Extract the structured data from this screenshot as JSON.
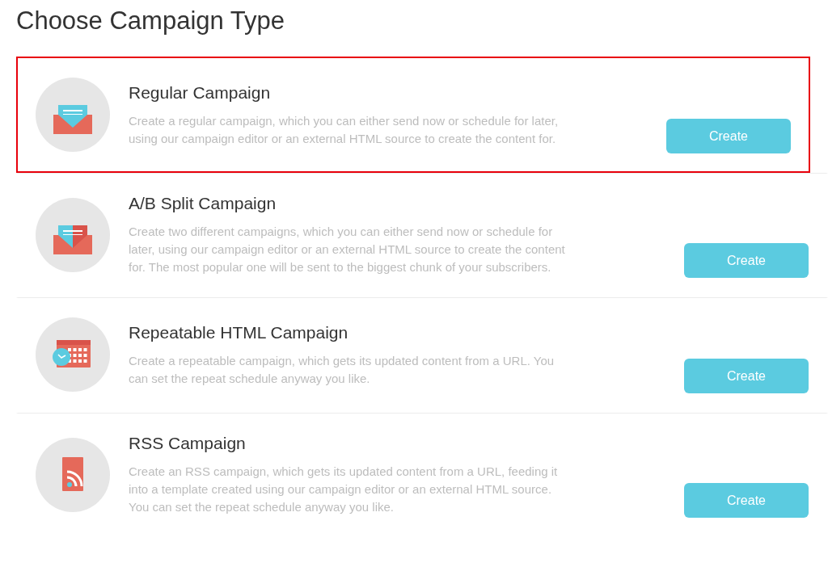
{
  "page_title": "Choose Campaign Type",
  "campaigns": [
    {
      "kind": "envelope",
      "title": "Regular Campaign",
      "description": "Create a regular campaign, which you can either send now or schedule for later, using our campaign editor or an external HTML source to create the content for.",
      "button": "Create",
      "selected": true
    },
    {
      "kind": "split-envelope",
      "title": "A/B Split Campaign",
      "description": "Create two different campaigns, which you can either send now or schedule for later, using our campaign editor or an external HTML source to create the content for. The most popular one will be sent to the biggest chunk of your subscribers.",
      "button": "Create",
      "selected": false
    },
    {
      "kind": "calendar-clock",
      "title": "Repeatable HTML Campaign",
      "description": "Create a repeatable campaign, which gets its updated content from a URL. You can set the repeat schedule anyway you like.",
      "button": "Create",
      "selected": false
    },
    {
      "kind": "rss",
      "title": "RSS Campaign",
      "description": "Create an RSS campaign, which gets its updated content from a URL, feeding it into a template created using our campaign editor or an external HTML source. You can set the repeat schedule anyway you like.",
      "button": "Create",
      "selected": false
    }
  ]
}
